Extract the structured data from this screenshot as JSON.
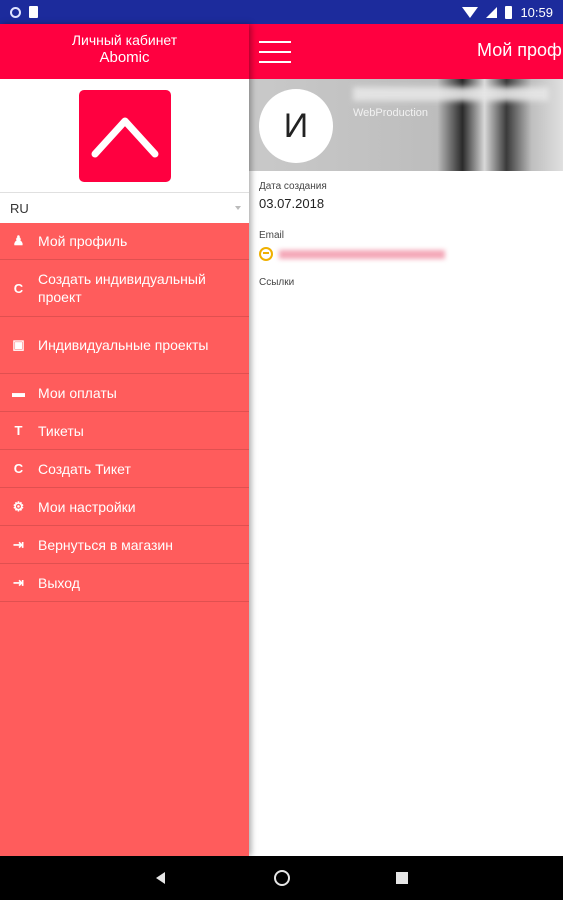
{
  "status_bar": {
    "time": "10:59"
  },
  "drawer": {
    "title_line1": "Личный кабинет",
    "title_line2": "Abomic",
    "language": "RU",
    "menu": [
      {
        "label": "Мой профиль",
        "icon": "profile-icon",
        "glyph": "♟"
      },
      {
        "label": "Создать индивидуальный проект",
        "icon": "letter-c-icon",
        "glyph": "C"
      },
      {
        "label": "Индивидуальные проекты",
        "icon": "clipboard-icon",
        "glyph": "▣"
      },
      {
        "label": "Мои оплаты",
        "icon": "payment-icon",
        "glyph": "▬"
      },
      {
        "label": "Тикеты",
        "icon": "letter-t-icon",
        "glyph": "T"
      },
      {
        "label": "Создать Тикет",
        "icon": "letter-c-icon",
        "glyph": "C"
      },
      {
        "label": "Мои настройки",
        "icon": "gear-icon",
        "glyph": "⚙"
      },
      {
        "label": "Вернуться в магазин",
        "icon": "sign-in-icon",
        "glyph": "⇥"
      },
      {
        "label": "Выход",
        "icon": "sign-in-icon",
        "glyph": "⇥"
      }
    ]
  },
  "main": {
    "title": "Мой профиль",
    "avatar_letter": "И",
    "company": "WebProduction",
    "created_label": "Дата создания",
    "created_value": "03.07.2018",
    "email_label": "Email",
    "links_label": "Ссылки"
  },
  "colors": {
    "accent": "#ff0040",
    "drawer_bg": "#ff5c5c",
    "status_bar": "#1c2b9c"
  }
}
